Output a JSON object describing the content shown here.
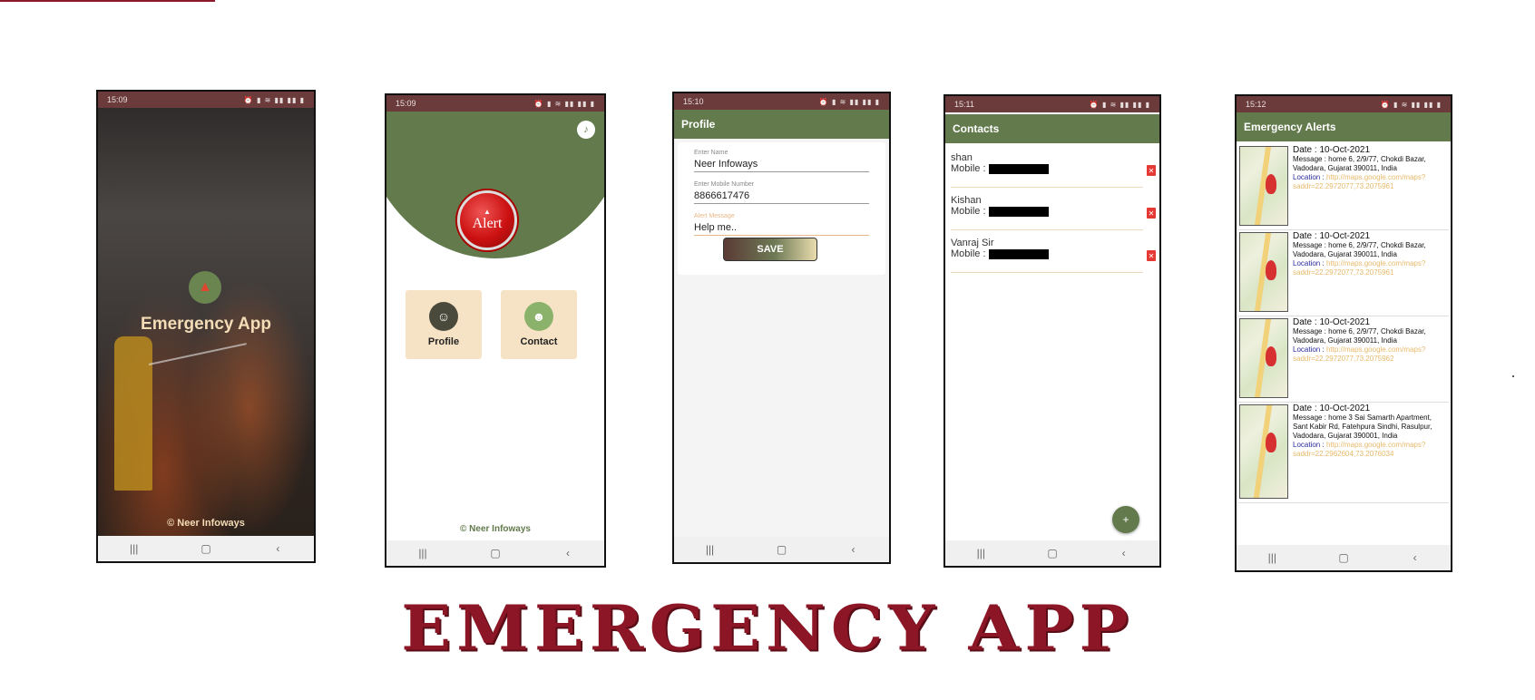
{
  "banner_title": "EMERGENCY APP",
  "colors": {
    "appbar": "#627a4c",
    "statusbar": "#6b3b3b",
    "title": "#8c1626",
    "tile": "#f6e3c5"
  },
  "phone1": {
    "time": "15:09",
    "status_icons": "⏰ ▮ ≋ ▮▮ ▮▮ ▮",
    "title": "Emergency App",
    "footer": "Neer Infoways",
    "copyright": "©"
  },
  "phone2": {
    "time": "15:09",
    "status_icons": "⏰ ▮ ≋ ▮▮ ▮▮ ▮",
    "alert_label": "Alert",
    "tiles": [
      {
        "label": "Profile"
      },
      {
        "label": "Contact"
      }
    ],
    "footer": "Neer Infoways",
    "copyright": "©"
  },
  "phone3": {
    "time": "15:10",
    "status_icons": "⏰ ▮ ≋ ▮▮ ▮▮ ▮",
    "appbar_title": "Profile",
    "fields": [
      {
        "label": "Enter Name",
        "value": "Neer Infoways"
      },
      {
        "label": "Enter Mobile Number",
        "value": "8866617476"
      },
      {
        "label": "Alert Message",
        "value": "Help me.."
      }
    ],
    "save_label": "SAVE"
  },
  "phone4": {
    "time": "15:11",
    "status_icons": "⏰ ▮ ≋ ▮▮ ▮▮ ▮",
    "appbar_title": "Contacts",
    "mobile_label": "Mobile :",
    "contacts": [
      {
        "name": "shan"
      },
      {
        "name": "Kishan"
      },
      {
        "name": "Vanraj Sir"
      }
    ]
  },
  "phone5": {
    "time": "15:12",
    "status_icons": "⏰ ▮ ≋ ▮▮ ▮▮ ▮",
    "appbar_title": "Emergency Alerts",
    "location_label": "Location :",
    "alerts": [
      {
        "date": "Date : 10-Oct-2021",
        "message": "Message : home 6, 2/9/77, Chokdi Bazar, Vadodara, Gujarat 390011, India",
        "link": "http://maps.google.com/maps?saddr=22.2972077,73.2075961"
      },
      {
        "date": "Date : 10-Oct-2021",
        "message": "Message : home 6, 2/9/77, Chokdi Bazar, Vadodara, Gujarat 390011, India",
        "link": "http://maps.google.com/maps?saddr=22.2972077,73.2075961"
      },
      {
        "date": "Date : 10-Oct-2021",
        "message": "Message : home 6, 2/9/77, Chokdi Bazar, Vadodara, Gujarat 390011, India",
        "link": "http://maps.google.com/maps?saddr=22.2972077,73.2075962"
      },
      {
        "date": "Date : 10-Oct-2021",
        "message": "Message : home 3 Sai Samarth Apartment, Sant Kabir Rd, Fatehpura Sindhi, Rasulpur, Vadodara, Gujarat 390001, India",
        "link": "http://maps.google.com/maps?saddr=22.2962604,73.2076034"
      }
    ]
  }
}
